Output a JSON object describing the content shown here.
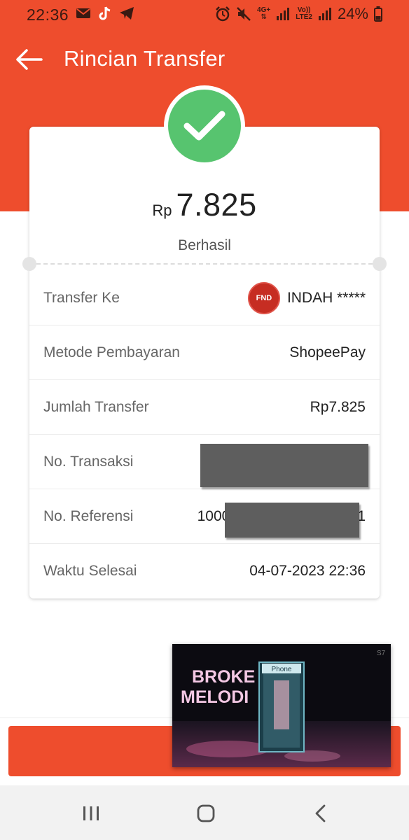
{
  "status_bar": {
    "time": "22:36",
    "battery": "24%",
    "net_4g_line1": "4G+",
    "volte_line1": "Vo))",
    "volte_line2": "LTE2",
    "left_icons": [
      "mail-icon",
      "tiktok-icon",
      "telegram-icon"
    ],
    "right_icons": [
      "alarm-icon",
      "mute-icon",
      "4g-icon",
      "signal-icon",
      "volte-icon",
      "signal-icon",
      "battery-icon"
    ]
  },
  "header": {
    "title": "Rincian Transfer"
  },
  "summary": {
    "currency": "Rp",
    "amount": "7.825",
    "status": "Berhasil"
  },
  "details": {
    "transfer_to": {
      "label": "Transfer Ke",
      "value": "INDAH *****"
    },
    "bank_logo_text": "FND",
    "payment_method": {
      "label": "Metode Pembayaran",
      "value": "ShopeePay"
    },
    "amount": {
      "label": "Jumlah Transfer",
      "value": "Rp7.825"
    },
    "transaction_no": {
      "label": "No. Transaksi"
    },
    "reference_no": {
      "label": "No. Referensi",
      "value_start": "1000",
      "value_end": "1"
    },
    "completed_time": {
      "label": "Waktu Selesai",
      "value": "04-07-2023 22:36"
    }
  },
  "video_overlay": {
    "line1": "BROKE",
    "line2": "MELODI",
    "booth_sign": "Phone",
    "corner_mark": "S7"
  },
  "colors": {
    "brand": "#ee4d2d",
    "success": "#57c46f"
  }
}
